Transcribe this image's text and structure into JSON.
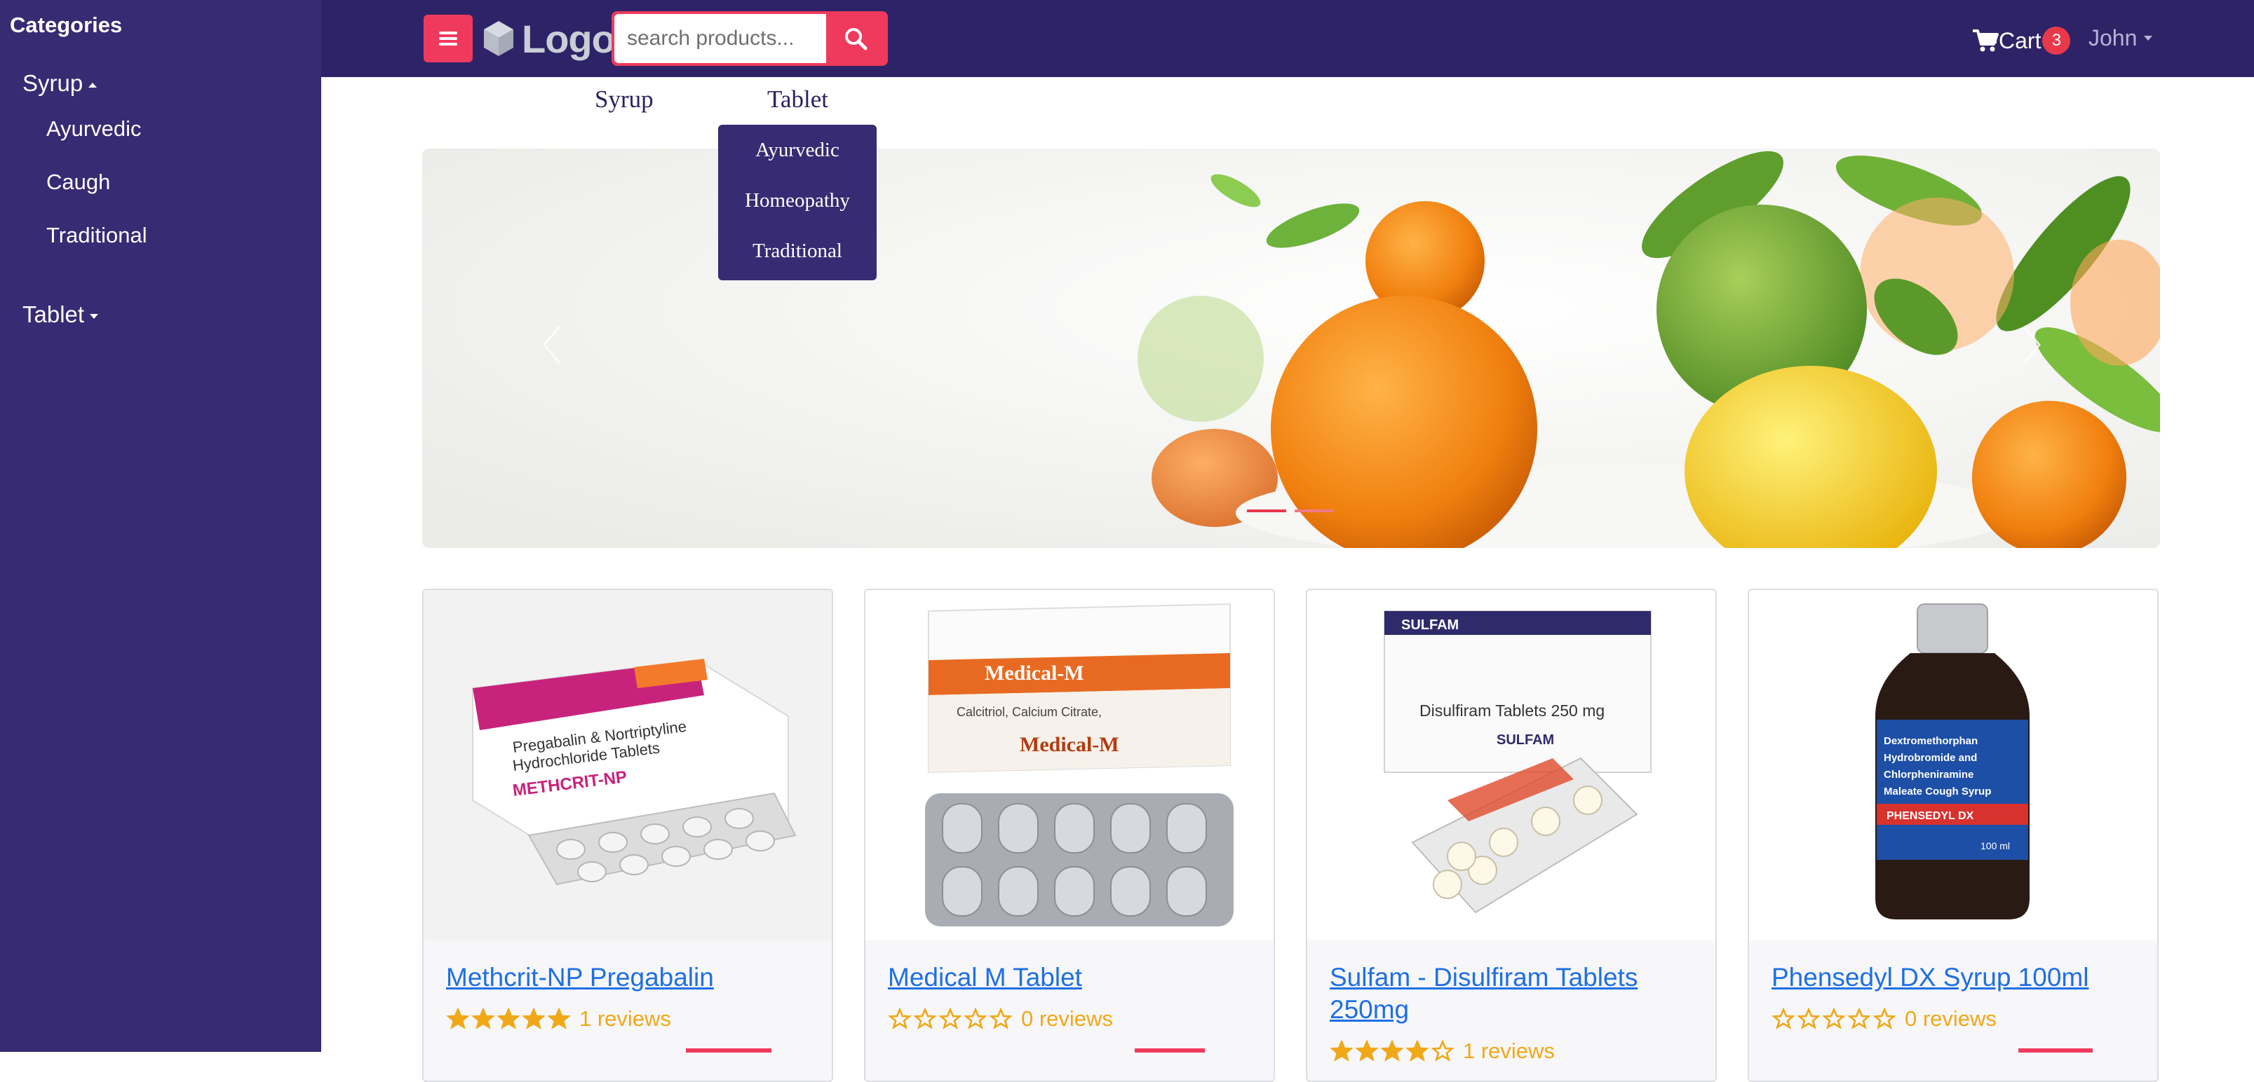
{
  "sidebar": {
    "title": "Categories",
    "groups": [
      {
        "label": "Syrup",
        "expanded": true,
        "items": [
          "Ayurvedic",
          "Caugh",
          "Traditional"
        ]
      },
      {
        "label": "Tablet",
        "expanded": false,
        "items": []
      }
    ]
  },
  "topbar": {
    "logo_text": "Logo",
    "search_placeholder": "search products...",
    "cart_label": "Cart",
    "cart_count": "3",
    "user_name": "John"
  },
  "category_nav": {
    "items": [
      "Syrup",
      "Tablet"
    ],
    "open_dropdown": [
      "Ayurvedic",
      "Homeopathy",
      "Traditional"
    ]
  },
  "banner": {
    "slide_count": 2,
    "active_slide": 1
  },
  "products": [
    {
      "title": "Methcrit-NP Pregabalin",
      "rating": 5,
      "reviews": "1 reviews",
      "image_text": [
        "Pregabalin & Nortriptyline",
        "Hydrochloride Tablets",
        "METHCRIT-NP"
      ]
    },
    {
      "title": "Medical M Tablet",
      "rating": 0,
      "reviews": "0 reviews",
      "image_text": [
        "Medical-M",
        "Calcitriol, Calcium Citrate,",
        "Medical-M"
      ]
    },
    {
      "title": "Sulfam - Disulfiram Tablets 250mg",
      "rating": 4,
      "reviews": "1 reviews",
      "image_text": [
        "SULFAM",
        "Disulfiram Tablets 250 mg",
        "SULFAM"
      ]
    },
    {
      "title": "Phensedyl DX Syrup 100ml",
      "rating": 0,
      "reviews": "0 reviews",
      "image_text": [
        "Dextromethorphan",
        "Hydrobromide and",
        "Chlorpheniramine",
        "Maleate Cough Syrup",
        "PHENSEDYL DX",
        "100 ml"
      ]
    }
  ],
  "colors": {
    "sidebar_bg": "#372b73",
    "topbar_bg": "#2f2367",
    "accent": "#ef3a5d",
    "link": "#1f6fe5",
    "star": "#f0a818"
  }
}
